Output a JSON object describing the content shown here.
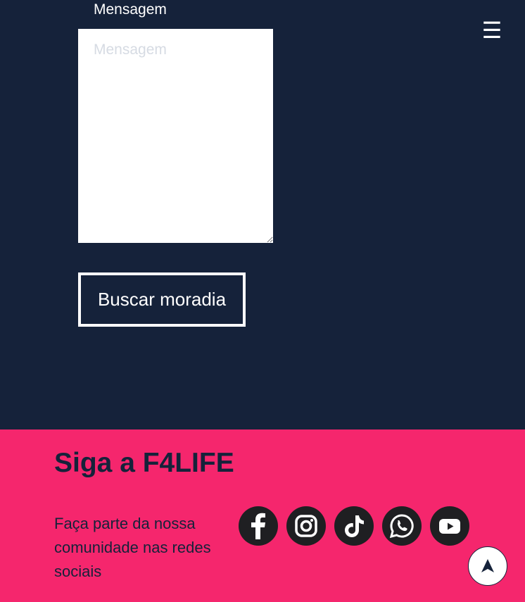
{
  "form": {
    "message_label": "Mensagem",
    "message_placeholder": "Mensagem",
    "message_value": "",
    "submit_label": "Buscar moradia"
  },
  "header": {
    "menu_icon": "hamburger-menu-icon",
    "menu_glyph": "☰"
  },
  "footer": {
    "title": "Siga a F4LIFE",
    "text": "Faça parte da nossa comunidade nas redes sociais",
    "socials": [
      {
        "name": "facebook",
        "icon": "facebook-icon"
      },
      {
        "name": "instagram",
        "icon": "instagram-icon"
      },
      {
        "name": "tiktok",
        "icon": "tiktok-icon"
      },
      {
        "name": "whatsapp",
        "icon": "whatsapp-icon"
      },
      {
        "name": "youtube",
        "icon": "youtube-icon"
      }
    ]
  },
  "scroll_top_icon": "arrow-up-icon",
  "colors": {
    "background_dark": "#15223a",
    "footer_pink": "#f5266d",
    "social_circle": "#1f1f22",
    "white": "#ffffff"
  }
}
